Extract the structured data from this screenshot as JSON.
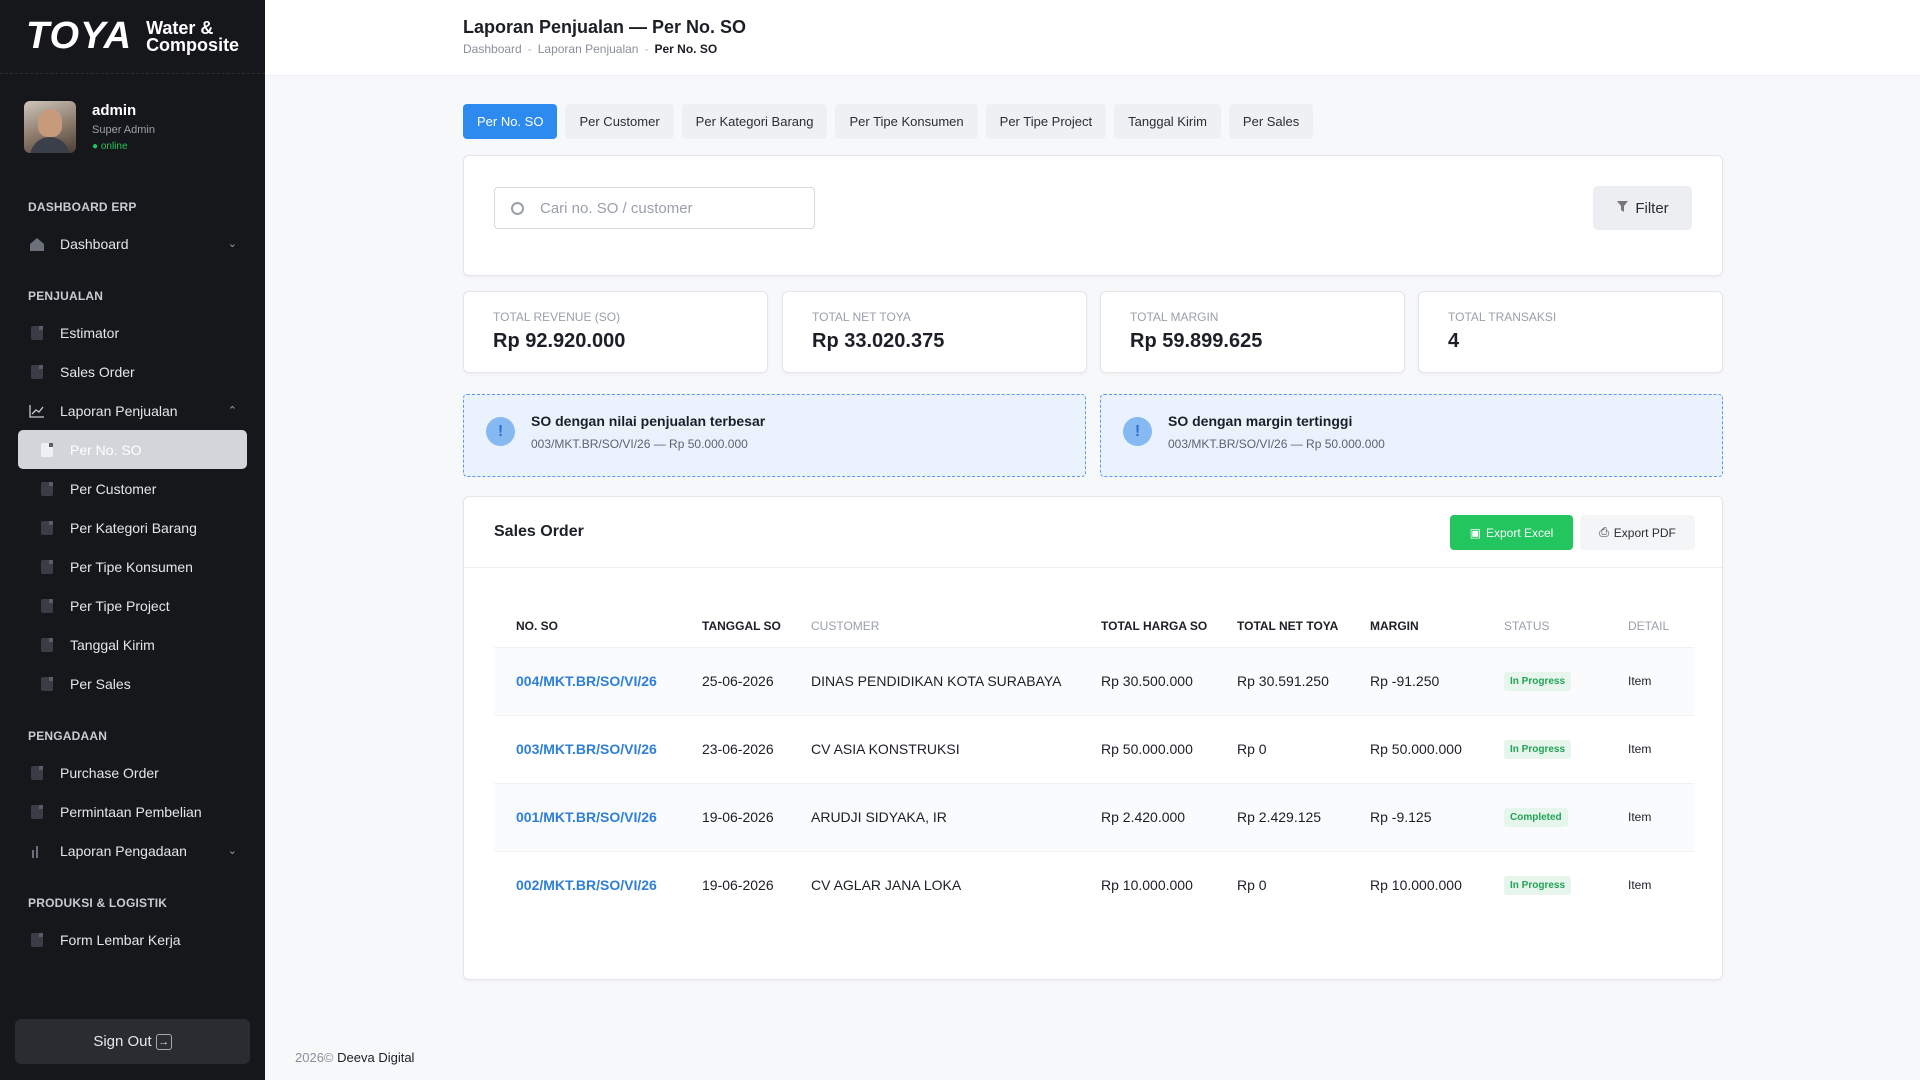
{
  "brand": {
    "logo": "TOYA",
    "sub_line1": "Water &",
    "sub_line2": "Composite"
  },
  "user": {
    "name": "admin",
    "role": "Super Admin",
    "status": "● online"
  },
  "sidebar": {
    "sections": [
      {
        "title": "DASHBOARD ERP"
      },
      {
        "title": "PENJUALAN"
      },
      {
        "title": "PENGADAAN"
      },
      {
        "title": "PRODUKSI & LOGISTIK"
      }
    ],
    "items": {
      "dashboard": "Dashboard",
      "estimator": "Estimator",
      "sales_order": "Sales Order",
      "laporan_penjualan": "Laporan Penjualan",
      "sub": [
        "Per No. SO",
        "Per Customer",
        "Per Kategori Barang",
        "Per Tipe Konsumen",
        "Per Tipe Project",
        "Tanggal Kirim",
        "Per Sales"
      ],
      "purchase_order": "Purchase Order",
      "permintaan_pembelian": "Permintaan Pembelian",
      "laporan_pengadaan": "Laporan Pengadaan",
      "form_lembar_kerja": "Form Lembar Kerja"
    },
    "signout": "Sign Out"
  },
  "header": {
    "title": "Laporan Penjualan — Per No. SO",
    "breadcrumb": [
      "Dashboard",
      "Laporan Penjualan",
      "Per No. SO"
    ]
  },
  "tabs": [
    "Per No. SO",
    "Per Customer",
    "Per Kategori Barang",
    "Per Tipe Konsumen",
    "Per Tipe Project",
    "Tanggal Kirim",
    "Per Sales"
  ],
  "search": {
    "placeholder": "Cari no. SO / customer",
    "filter_label": "Filter"
  },
  "stats": [
    {
      "label": "TOTAL REVENUE (SO)",
      "value": "Rp 92.920.000"
    },
    {
      "label": "TOTAL NET TOYA",
      "value": "Rp 33.020.375"
    },
    {
      "label": "TOTAL MARGIN",
      "value": "Rp 59.899.625"
    },
    {
      "label": "TOTAL TRANSAKSI",
      "value": "4"
    }
  ],
  "insights": [
    {
      "title": "SO dengan nilai penjualan terbesar",
      "detail": "003/MKT.BR/SO/VI/26 — Rp 50.000.000"
    },
    {
      "title": "SO dengan margin tertinggi",
      "detail": "003/MKT.BR/SO/VI/26 — Rp 50.000.000"
    }
  ],
  "table": {
    "title": "Sales Order",
    "export_excel": "Export Excel",
    "export_pdf": "Export PDF",
    "columns": [
      "NO. SO",
      "TANGGAL SO",
      "CUSTOMER",
      "TOTAL HARGA SO",
      "TOTAL NET TOYA",
      "MARGIN",
      "STATUS",
      "DETAIL"
    ],
    "rows": [
      {
        "no_so": "004/MKT.BR/SO/VI/26",
        "tanggal": "25-06-2026",
        "customer": "DINAS PENDIDIKAN KOTA SURABAYA",
        "total_harga": "Rp 30.500.000",
        "net_toya": "Rp 30.591.250",
        "margin": "Rp -91.250",
        "status": "In Progress",
        "detail": "Item"
      },
      {
        "no_so": "003/MKT.BR/SO/VI/26",
        "tanggal": "23-06-2026",
        "customer": "CV ASIA KONSTRUKSI",
        "total_harga": "Rp 50.000.000",
        "net_toya": "Rp 0",
        "margin": "Rp 50.000.000",
        "status": "In Progress",
        "detail": "Item"
      },
      {
        "no_so": "001/MKT.BR/SO/VI/26",
        "tanggal": "19-06-2026",
        "customer": "ARUDJI SIDYAKA, IR",
        "total_harga": "Rp 2.420.000",
        "net_toya": "Rp 2.429.125",
        "margin": "Rp -9.125",
        "status": "Completed",
        "detail": "Item"
      },
      {
        "no_so": "002/MKT.BR/SO/VI/26",
        "tanggal": "19-06-2026",
        "customer": "CV AGLAR JANA LOKA",
        "total_harga": "Rp 10.000.000",
        "net_toya": "Rp 0",
        "margin": "Rp 10.000.000",
        "status": "In Progress",
        "detail": "Item"
      }
    ]
  },
  "footer": {
    "year": "2026©",
    "company": "Deeva Digital"
  },
  "colors": {
    "accent": "#2d8bf0",
    "success": "#22c55e",
    "sidebar_bg": "#16171b",
    "link": "#2d7fd8"
  }
}
